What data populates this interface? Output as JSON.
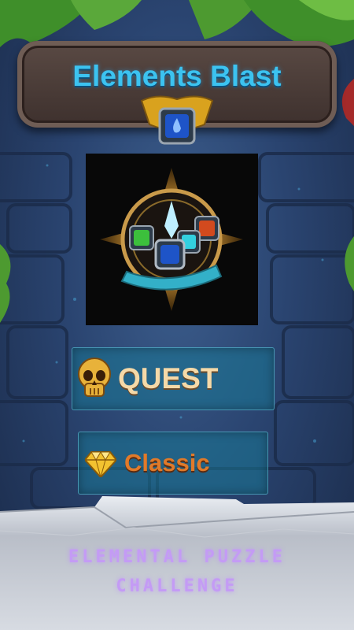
{
  "game": {
    "title": "Elements Blast",
    "tagline_line1": "ELEMENTAL PUZZLE",
    "tagline_line2": "CHALLENGE"
  },
  "menu": {
    "quest_label": "QUEST",
    "classic_label": "Classic"
  },
  "icons": {
    "trophy": "trophy-icon",
    "quest": "skull-icon",
    "classic": "diamond-icon",
    "emblem": "elements-emblem"
  },
  "colors": {
    "title": "#3cc3f0",
    "quest_text": "#f5d9a8",
    "classic_text": "#e07a2a",
    "tagline": "#c49bf5",
    "button_fill": "#197896"
  }
}
